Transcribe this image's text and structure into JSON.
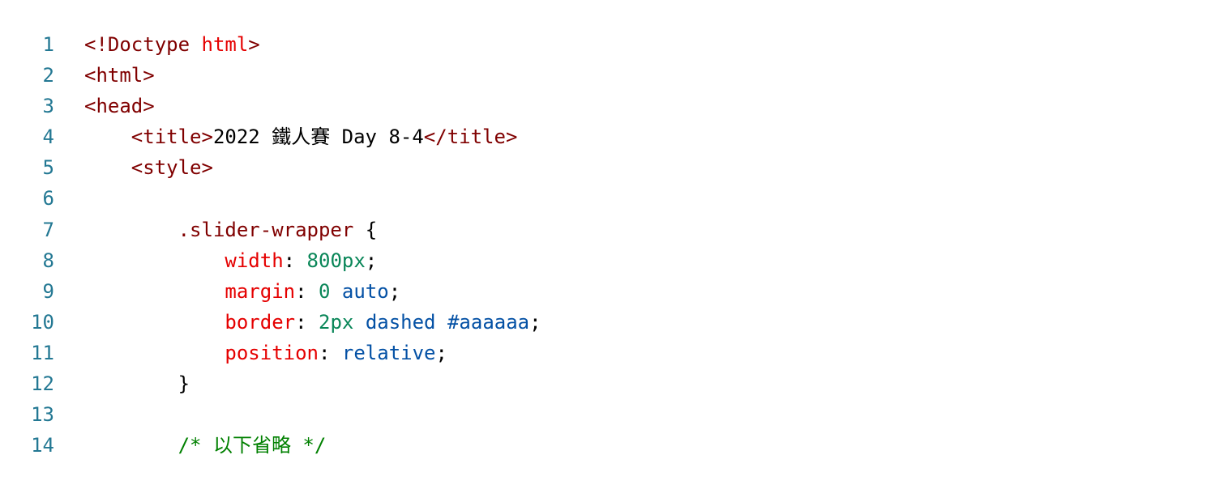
{
  "editor": {
    "colors": {
      "line_number": "#237893",
      "tag": "#800000",
      "attribute": "#e50000",
      "selector": "#800000",
      "property": "#e50000",
      "number": "#098658",
      "keyword_value": "#0451a5",
      "comment": "#008000",
      "punctuation": "#000000"
    },
    "lines": [
      {
        "number": "1",
        "tokens": [
          {
            "text": "<!Doctype",
            "color": "#800000"
          },
          {
            "text": " ",
            "color": "#000000"
          },
          {
            "text": "html",
            "color": "#e50000"
          },
          {
            "text": ">",
            "color": "#800000"
          }
        ]
      },
      {
        "number": "2",
        "tokens": [
          {
            "text": "<html>",
            "color": "#800000"
          }
        ]
      },
      {
        "number": "3",
        "tokens": [
          {
            "text": "<head>",
            "color": "#800000"
          }
        ]
      },
      {
        "number": "4",
        "tokens": [
          {
            "text": "    <title>",
            "color": "#800000"
          },
          {
            "text": "2022 鐵人賽 Day 8-4",
            "color": "#000000"
          },
          {
            "text": "</title>",
            "color": "#800000"
          }
        ]
      },
      {
        "number": "5",
        "tokens": [
          {
            "text": "    <style>",
            "color": "#800000"
          }
        ]
      },
      {
        "number": "6",
        "tokens": []
      },
      {
        "number": "7",
        "tokens": [
          {
            "text": "        .slider-wrapper",
            "color": "#800000"
          },
          {
            "text": " {",
            "color": "#000000"
          }
        ]
      },
      {
        "number": "8",
        "tokens": [
          {
            "text": "            width",
            "color": "#e50000"
          },
          {
            "text": ": ",
            "color": "#000000"
          },
          {
            "text": "800px",
            "color": "#098658"
          },
          {
            "text": ";",
            "color": "#000000"
          }
        ]
      },
      {
        "number": "9",
        "tokens": [
          {
            "text": "            margin",
            "color": "#e50000"
          },
          {
            "text": ": ",
            "color": "#000000"
          },
          {
            "text": "0",
            "color": "#098658"
          },
          {
            "text": " ",
            "color": "#000000"
          },
          {
            "text": "auto",
            "color": "#0451a5"
          },
          {
            "text": ";",
            "color": "#000000"
          }
        ]
      },
      {
        "number": "10",
        "tokens": [
          {
            "text": "            border",
            "color": "#e50000"
          },
          {
            "text": ": ",
            "color": "#000000"
          },
          {
            "text": "2px",
            "color": "#098658"
          },
          {
            "text": " ",
            "color": "#000000"
          },
          {
            "text": "dashed",
            "color": "#0451a5"
          },
          {
            "text": " ",
            "color": "#000000"
          },
          {
            "text": "#aaaaaa",
            "color": "#0451a5"
          },
          {
            "text": ";",
            "color": "#000000"
          }
        ]
      },
      {
        "number": "11",
        "tokens": [
          {
            "text": "            position",
            "color": "#e50000"
          },
          {
            "text": ": ",
            "color": "#000000"
          },
          {
            "text": "relative",
            "color": "#0451a5"
          },
          {
            "text": ";",
            "color": "#000000"
          }
        ]
      },
      {
        "number": "12",
        "tokens": [
          {
            "text": "        }",
            "color": "#000000"
          }
        ]
      },
      {
        "number": "13",
        "tokens": []
      },
      {
        "number": "14",
        "tokens": [
          {
            "text": "        /* 以下省略 */",
            "color": "#008000"
          }
        ]
      }
    ]
  }
}
